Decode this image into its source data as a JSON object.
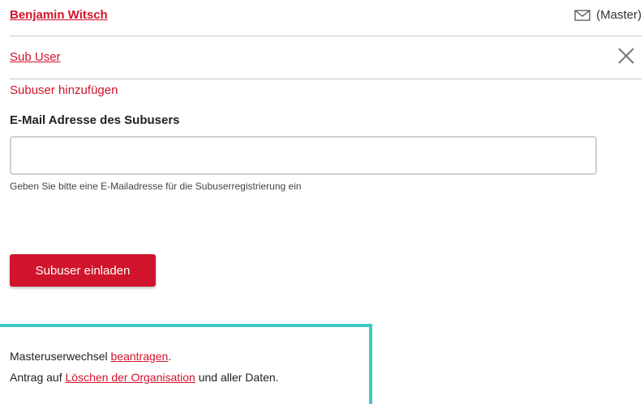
{
  "header": {
    "user_name": "Benjamin Witsch",
    "role_label": "(Master)",
    "mail_icon": "mail-icon"
  },
  "subuser_section": {
    "link_label": "Sub User",
    "close_icon": "close-icon",
    "add_title": "Subuser hinzufügen",
    "email_label": "E-Mail Adresse des Subusers",
    "email_value": "",
    "email_placeholder": "",
    "hint": "Geben Sie bitte eine E-Mailadresse für die Subuserregistrierung ein",
    "invite_button": "Subuser einladen"
  },
  "footer_box": {
    "line1_prefix": "Masteruserwechsel ",
    "line1_link": "beantragen",
    "line1_suffix": ".",
    "line2_prefix": "Antrag auf ",
    "line2_link": "Löschen der Organisation",
    "line2_suffix": " und aller Daten."
  },
  "colors": {
    "accent": "#d0142b",
    "highlight_border": "#3ec9c4",
    "divider": "#c8c8c8"
  }
}
